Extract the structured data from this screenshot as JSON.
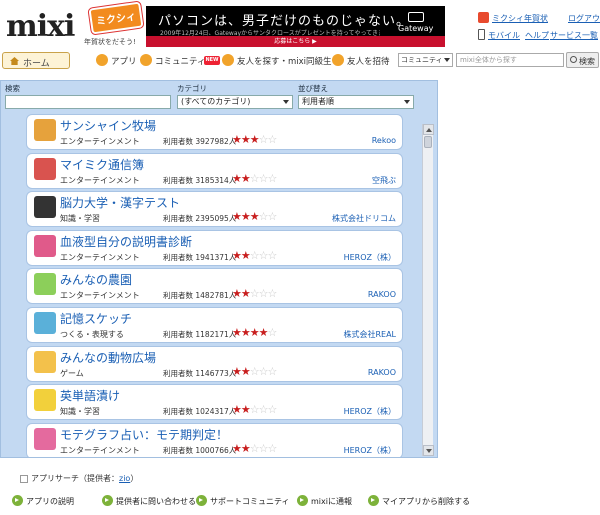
{
  "header": {
    "logo_text": "mixi",
    "logo_badge": "ミクシィ",
    "logo_tagline": "年賀状をだそう!",
    "banner": {
      "main": "パソコンは、男子だけのものじゃない。",
      "sub": "2009年12月24日、Gatewayからサンタクロースがプレゼントを持ってやってきます。",
      "cta": "応募はこちら ▶",
      "brand": "Gateway"
    },
    "links": {
      "nengajo": "ミクシィ年賀状",
      "logout": "ログアウト",
      "mobile": "モバイル",
      "help": "ヘルプ",
      "service": "サービス一覧"
    }
  },
  "nav": {
    "home": "ホーム",
    "app": "アプリ",
    "community": "コミュニティ",
    "new_tag": "NEW",
    "find_friends": "友人を探す・mixi同級生",
    "invite": "友人を招待",
    "search_category": "コミュニティ",
    "search_placeholder": "mixi全体から探す",
    "search_button": "検索"
  },
  "filters": {
    "keyword_label": "検索",
    "category_label": "カテゴリ",
    "category_value": "(すべてのカテゴリ)",
    "sort_label": "並び替え",
    "sort_value": "利用者順"
  },
  "apps": [
    {
      "name": "サンシャイン牧場",
      "category": "エンターテインメント",
      "users": "利用者数 3927982人",
      "rating": 3,
      "provider": "Rekoo",
      "thumb_color": "#e6a23c"
    },
    {
      "name": "マイミク通信簿",
      "category": "エンターテインメント",
      "users": "利用者数 3185314人",
      "rating": 2,
      "provider": "空飛ぶ",
      "thumb_color": "#d9534f"
    },
    {
      "name": "脳力大学・漢字テスト",
      "category": "知識・学習",
      "users": "利用者数 2395095人",
      "rating": 3,
      "provider": "株式会社ドリコム",
      "thumb_color": "#333333"
    },
    {
      "name": "血液型自分の説明書診断",
      "category": "エンターテインメント",
      "users": "利用者数 1941371人",
      "rating": 2,
      "provider": "HEROZ（株）",
      "thumb_color": "#e05a8a"
    },
    {
      "name": "みんなの農園",
      "category": "エンターテインメント",
      "users": "利用者数 1482781人",
      "rating": 2,
      "provider": "RAKOO",
      "thumb_color": "#8ccf5a"
    },
    {
      "name": "記憶スケッチ",
      "category": "つくる・表現する",
      "users": "利用者数 1182171人",
      "rating": 4,
      "provider": "株式会社REAL",
      "thumb_color": "#5ab0d9"
    },
    {
      "name": "みんなの動物広場",
      "category": "ゲーム",
      "users": "利用者数 1146773人",
      "rating": 2,
      "provider": "RAKOO",
      "thumb_color": "#f3c14b"
    },
    {
      "name": "英単語漬け",
      "category": "知識・学習",
      "users": "利用者数 1024317人",
      "rating": 2,
      "provider": "HEROZ（株）",
      "thumb_color": "#f2d03b"
    },
    {
      "name": "モテグラフ占い：モテ期判定！",
      "category": "エンターテインメント",
      "users": "利用者数 1000766人",
      "rating": 2,
      "provider": "HEROZ（株）",
      "thumb_color": "#e46a9e"
    }
  ],
  "footer": {
    "title_prefix": "アプリサーチ（提供者：",
    "provider_link": "zio",
    "title_suffix": "）",
    "links": [
      "アプリの説明",
      "提供者に問い合わせる",
      "サポートコミュニティ",
      "mixiに通報",
      "マイアプリから削除する"
    ]
  },
  "colors": {
    "panel_bg": "#c3d9f2",
    "link": "#1a5fb4",
    "star_on": "#c81e1e",
    "accent_orange": "#f1a32b",
    "footer_icon": "#7db23a"
  }
}
